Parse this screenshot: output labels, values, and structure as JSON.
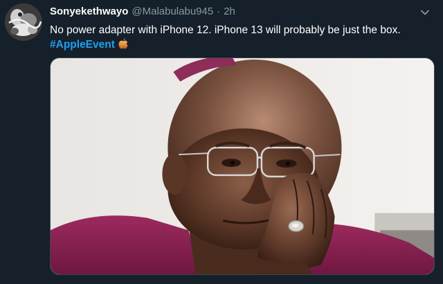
{
  "tweet": {
    "display_name": "Sonyekethwayo",
    "handle": "@Malabulabu945",
    "separator": "·",
    "time": "2h",
    "text": "No power adapter with iPhone 12. iPhone 13 will probably be just the box.",
    "hashtag": "#AppleEvent",
    "emoji": "apple-emoji"
  },
  "colors": {
    "background": "#15202b",
    "text": "#ffffff",
    "muted": "#8899a6",
    "link": "#1da1f2"
  },
  "icons": {
    "menu": "chevron-down-icon"
  }
}
